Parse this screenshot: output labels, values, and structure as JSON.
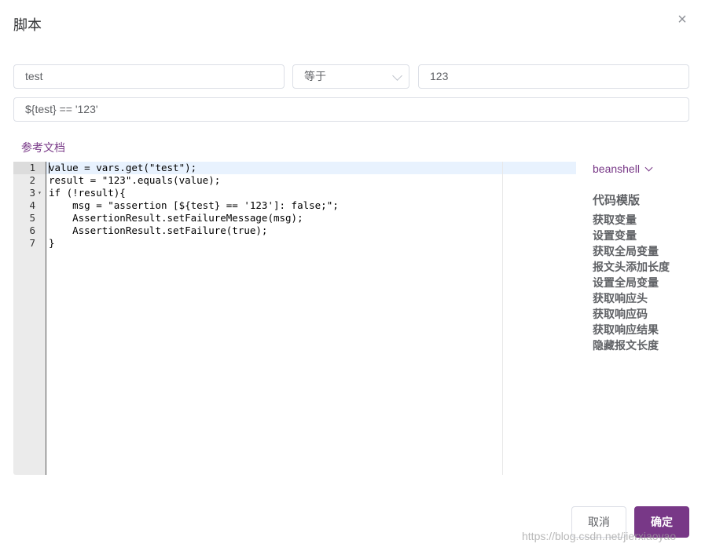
{
  "dialog": {
    "title": "脚本",
    "close_glyph": "×",
    "close_icon": "close-icon"
  },
  "condition": {
    "variable": {
      "value": "test"
    },
    "operator": {
      "value": "等于"
    },
    "expected": {
      "value": "123"
    },
    "expression": {
      "value": "${test} == '123'"
    }
  },
  "doc_link": "参考文档",
  "editor": {
    "line_numbers": [
      "1",
      "2",
      "3",
      "4",
      "5",
      "6",
      "7"
    ],
    "lines": [
      "value = vars.get(\"test\");",
      "result = \"123\".equals(value);",
      "if (!result){",
      "    msg = \"assertion [${test} == '123']: false;\";",
      "    AssertionResult.setFailureMessage(msg);",
      "    AssertionResult.setFailure(true);",
      "}"
    ],
    "fold_glyph": "▾"
  },
  "language": {
    "selected": "beanshell"
  },
  "templates": {
    "title": "代码模版",
    "items": [
      "获取变量",
      "设置变量",
      "获取全局变量",
      "报文头添加长度",
      "设置全局变量",
      "获取响应头",
      "获取响应码",
      "获取响应结果",
      "隐藏报文长度"
    ]
  },
  "footer": {
    "cancel_label": "取消",
    "confirm_label": "确定"
  },
  "watermark": "https://blog.csdn.net/jierxiaoyao",
  "colors": {
    "accent": "#783887",
    "active_line": "#e8f2fe",
    "gutter": "#ebebeb"
  }
}
